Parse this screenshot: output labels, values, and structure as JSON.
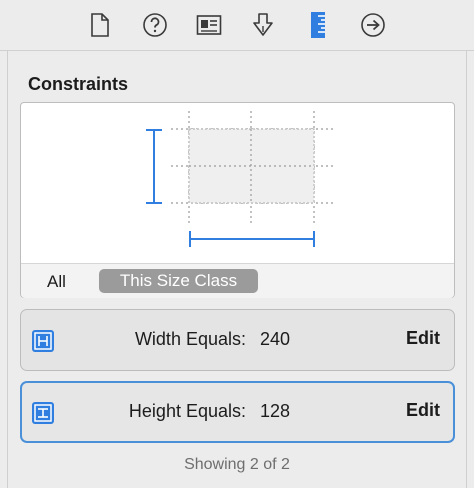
{
  "toolbar": {
    "icons": [
      "file-inspector-icon",
      "quick-help-icon",
      "identity-inspector-icon",
      "attributes-inspector-icon",
      "size-inspector-icon",
      "connections-inspector-icon"
    ]
  },
  "constraints": {
    "title": "Constraints",
    "segments": {
      "all_label": "All",
      "size_class_label": "This Size Class"
    }
  },
  "rows": [
    {
      "label": "Width Equals:",
      "value": "240",
      "edit_label": "Edit",
      "icon": "width-constraint-icon"
    },
    {
      "label": "Height Equals:",
      "value": "128",
      "edit_label": "Edit",
      "icon": "height-constraint-icon"
    }
  ],
  "footer": {
    "status": "Showing 2 of 2"
  },
  "colors": {
    "accent": "#2f7ee0",
    "selection_border": "#4a90d9",
    "segment_selected": "#9b9b9b"
  }
}
